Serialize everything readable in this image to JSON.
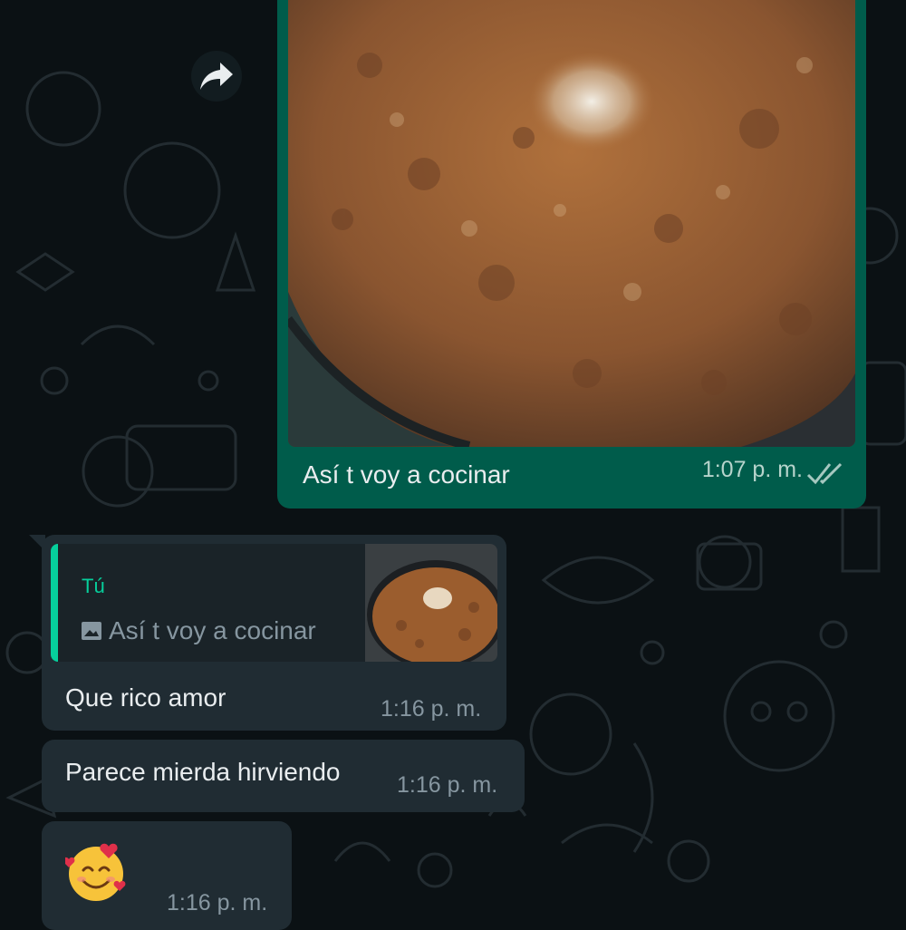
{
  "messages": {
    "outgoing_image": {
      "caption": "Así t voy a cocinar",
      "time": "1:07 p. m.",
      "status_icon": "double-check-icon"
    },
    "reply": {
      "quoted_sender": "Tú",
      "quoted_icon": "image-icon",
      "quoted_text": "Así t voy a cocinar",
      "text": "Que rico amor",
      "time": "1:16 p. m."
    },
    "second": {
      "text": "Parece mierda hirviendo",
      "time": "1:16 p. m."
    },
    "third": {
      "emoji": "smiling-face-with-hearts",
      "time": "1:16 p. m."
    }
  },
  "colors": {
    "chat_background": "#0b1114",
    "outgoing_bubble": "#005c4b",
    "incoming_bubble": "#202c33",
    "quote_accent": "#06cf9c",
    "read_ticks": "#a6c8c0"
  }
}
